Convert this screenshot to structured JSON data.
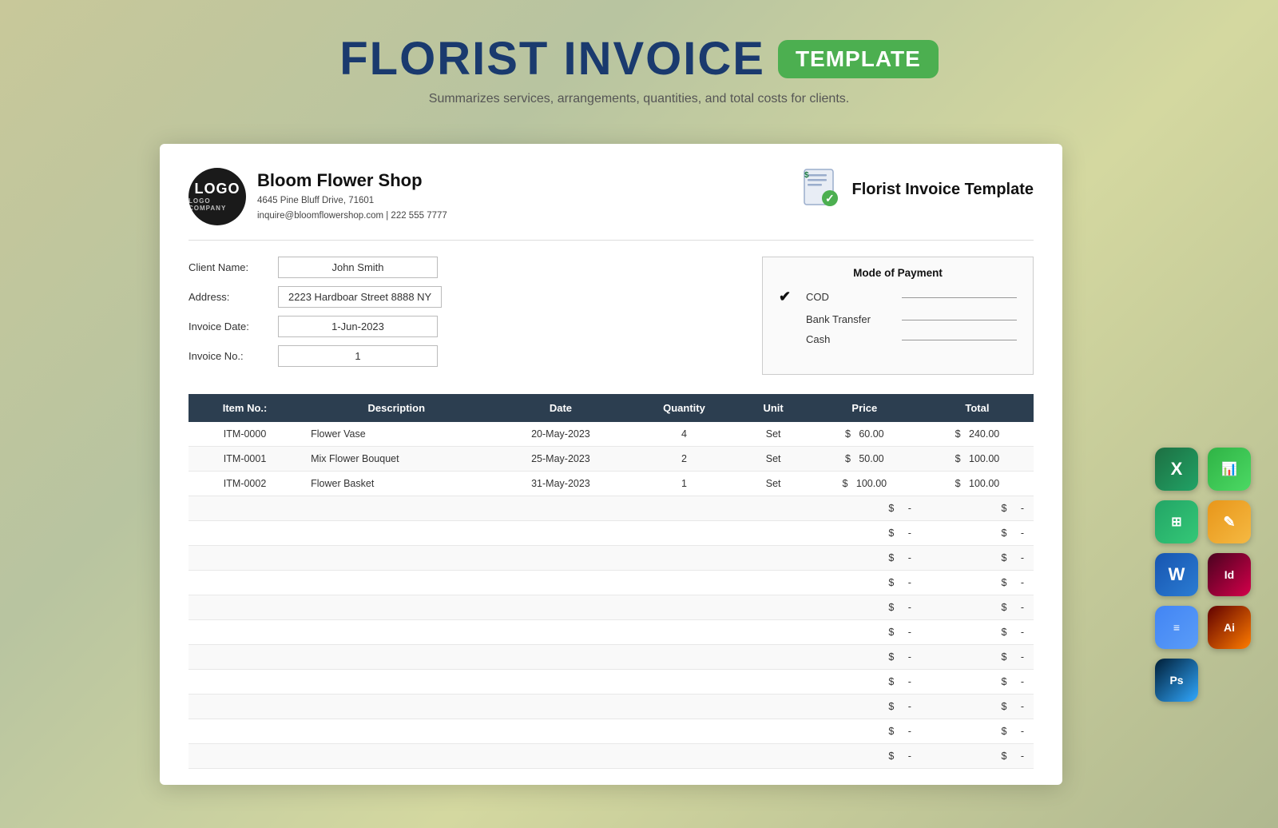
{
  "page": {
    "title_main": "FLORIST INVOICE",
    "title_badge": "TEMPLATE",
    "subtitle": "Summarizes services, arrangements, quantities, and total costs for clients."
  },
  "company": {
    "logo_text_big": "LOGO",
    "logo_text_small": "LOGO COMPANY",
    "name": "Bloom Flower Shop",
    "address": "4645 Pine Bluff Drive, 71601",
    "email_phone": "inquire@bloomflowershop.com | 222 555 7777",
    "invoice_title": "Florist Invoice Template"
  },
  "client": {
    "name_label": "Client Name:",
    "name_value": "John Smith",
    "address_label": "Address:",
    "address_value": "2223 Hardboar Street 8888 NY",
    "date_label": "Invoice Date:",
    "date_value": "1-Jun-2023",
    "invoice_no_label": "Invoice No.:",
    "invoice_no_value": "1"
  },
  "payment": {
    "title": "Mode of Payment",
    "methods": [
      {
        "label": "COD",
        "checked": true
      },
      {
        "label": "Bank Transfer",
        "checked": false
      },
      {
        "label": "Cash",
        "checked": false
      }
    ]
  },
  "table": {
    "headers": [
      "Item No.:",
      "Description",
      "Date",
      "Quantity",
      "Unit",
      "Price",
      "Total"
    ],
    "rows": [
      {
        "item_no": "ITM-0000",
        "description": "Flower Vase",
        "date": "20-May-2023",
        "quantity": "4",
        "unit": "Set",
        "price_symbol": "$",
        "price": "60.00",
        "total_symbol": "$",
        "total": "240.00"
      },
      {
        "item_no": "ITM-0001",
        "description": "Mix Flower Bouquet",
        "date": "25-May-2023",
        "quantity": "2",
        "unit": "Set",
        "price_symbol": "$",
        "price": "50.00",
        "total_symbol": "$",
        "total": "100.00"
      },
      {
        "item_no": "ITM-0002",
        "description": "Flower Basket",
        "date": "31-May-2023",
        "quantity": "1",
        "unit": "Set",
        "price_symbol": "$",
        "price": "100.00",
        "total_symbol": "$",
        "total": "100.00"
      }
    ],
    "empty_rows": 11
  },
  "app_icons": [
    {
      "name": "excel",
      "label": "X",
      "class": "excel"
    },
    {
      "name": "numbers",
      "label": "▦",
      "class": "numbers"
    },
    {
      "name": "sheets",
      "label": "⊞",
      "class": "sheets"
    },
    {
      "name": "pages",
      "label": "✎",
      "class": "pages"
    },
    {
      "name": "word",
      "label": "W",
      "class": "word"
    },
    {
      "name": "indesign",
      "label": "Id",
      "class": "indesign"
    },
    {
      "name": "gdocs",
      "label": "≡",
      "class": "gdocs"
    },
    {
      "name": "illustrator",
      "label": "Ai",
      "class": "illustrator"
    },
    {
      "name": "photoshop",
      "label": "Ps",
      "class": "photoshop"
    }
  ]
}
